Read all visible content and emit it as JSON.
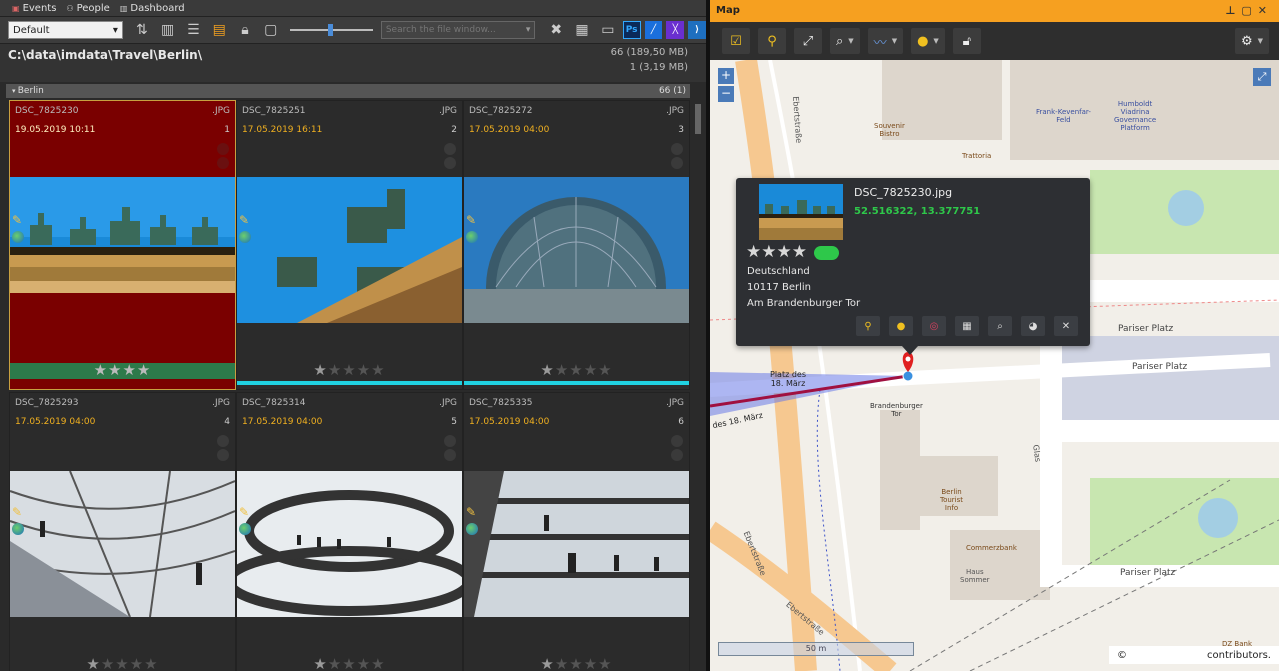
{
  "tabs": [
    {
      "label": "Events"
    },
    {
      "label": "People"
    },
    {
      "label": "Dashboard"
    }
  ],
  "toolbar": {
    "view_select": "Default",
    "search_placeholder": "Search the file window...",
    "app_icons": [
      "Ps"
    ]
  },
  "path": {
    "title": "C:\\data\\imdata\\Travel\\Berlin\\",
    "count_total": "66 (189,50 MB)",
    "count_selected": "1 (3,19 MB)"
  },
  "group": {
    "label": "Berlin",
    "count": "66 (1)"
  },
  "files": [
    {
      "name": "DSC_7825230",
      "ext": ".JPG",
      "date": "19.05.2019 10:11",
      "index": "1",
      "rating": 4
    },
    {
      "name": "DSC_7825251",
      "ext": ".JPG",
      "date": "17.05.2019 16:11",
      "index": "2",
      "rating": 1
    },
    {
      "name": "DSC_7825272",
      "ext": ".JPG",
      "date": "17.05.2019 04:00",
      "index": "3",
      "rating": 1
    },
    {
      "name": "DSC_7825293",
      "ext": ".JPG",
      "date": "17.05.2019 04:00",
      "index": "4",
      "rating": 1
    },
    {
      "name": "DSC_7825314",
      "ext": ".JPG",
      "date": "17.05.2019 04:00",
      "index": "5",
      "rating": 1
    },
    {
      "name": "DSC_7825335",
      "ext": ".JPG",
      "date": "17.05.2019 04:00",
      "index": "6",
      "rating": 1
    }
  ],
  "map": {
    "title": "Map",
    "popup": {
      "filename": "DSC_7825230.jpg",
      "coords": "52.516322, 13.377751",
      "rating": 4,
      "country": "Deutschland",
      "city": "10117 Berlin",
      "street": "Am Brandenburger Tor"
    },
    "labels": {
      "pariser1": "Pariser Platz",
      "pariser2": "Pariser Platz",
      "pariser3": "Pariser Platz",
      "platz_line1": "Platz des",
      "platz_line2": "18. März",
      "platz2": "des 18. März",
      "brandenburger_line1": "Brandenburger",
      "brandenburger_line2": "Tor",
      "ebertstrasse1": "Ebertstraße",
      "ebertstrasse2": "Ebertstraße",
      "ebertstrasse3": "Ebertstraße",
      "tourist_line1": "Berlin",
      "tourist_line2": "Tourist",
      "tourist_line3": "Info",
      "commerzbank": "Commerzbank",
      "haus_line1": "Haus",
      "haus_line2": "Sommer",
      "souvenir_line1": "Souvenir",
      "souvenir_line2": "Bistro",
      "humboldt_line1": "Humboldt",
      "humboldt_line2": "Viadrina",
      "humboldt_line3": "Governance",
      "humboldt_line4": "Platform",
      "fes_line1": "Frank-Kevenfar-",
      "fes_line2": "Feld",
      "trattoria": "Trattoria",
      "dz_line1": "DZ Bank",
      "glass_line1": "Glas"
    },
    "scale": "50 m",
    "copyright": "©",
    "contributors": "contributors."
  },
  "colors": {
    "accent_orange": "#f6a020",
    "selection_red": "#7a0000",
    "coord_green": "#2ec84a",
    "rating_cyan": "#20d0e0"
  }
}
